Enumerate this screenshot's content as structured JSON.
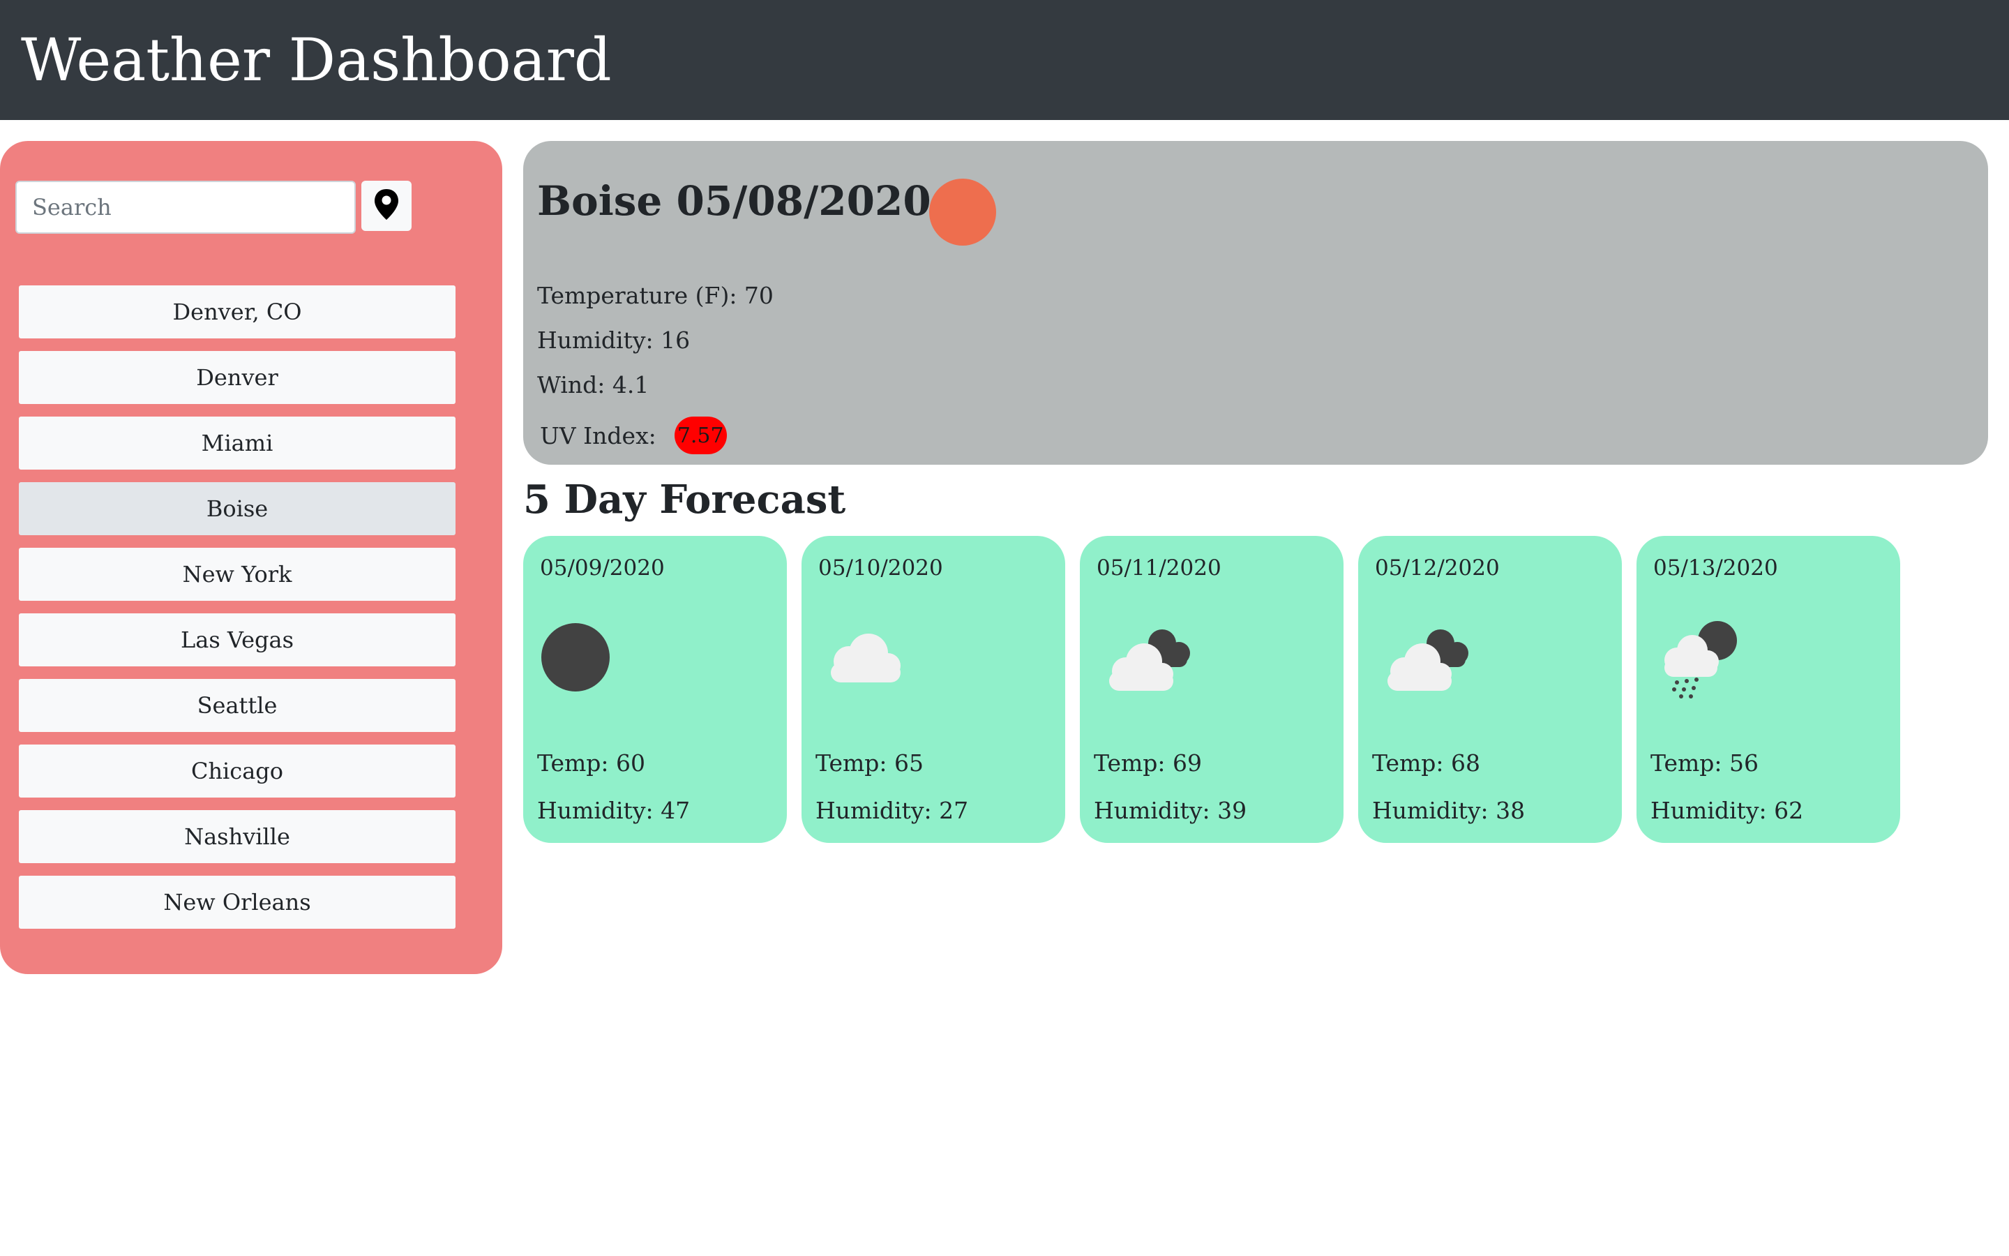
{
  "header": {
    "title": "Weather Dashboard"
  },
  "search": {
    "placeholder": "Search",
    "value": "",
    "locate_icon": "map-pin-icon"
  },
  "sidebar": {
    "active_city": "Boise",
    "cities": [
      "Denver, CO",
      "Denver",
      "Miami",
      "Boise",
      "New York",
      "Las Vegas",
      "Seattle",
      "Chicago",
      "Nashville",
      "New Orleans"
    ]
  },
  "current": {
    "title": "Boise 05/08/2020",
    "icon": "sun-icon",
    "temperature": "Temperature (F): 70",
    "humidity": "Humidity: 16",
    "wind": "Wind: 4.1",
    "uv_label": "UV Index:",
    "uv_value": "7.57",
    "uv_color": "#ff0000"
  },
  "forecast": {
    "heading": "5 Day Forecast",
    "days": [
      {
        "date": "05/09/2020",
        "icon": "clear-night-icon",
        "temp": "Temp: 60",
        "humidity": "Humidity: 47"
      },
      {
        "date": "05/10/2020",
        "icon": "cloud-icon",
        "temp": "Temp: 65",
        "humidity": "Humidity: 27"
      },
      {
        "date": "05/11/2020",
        "icon": "broken-clouds-icon",
        "temp": "Temp: 69",
        "humidity": "Humidity: 39"
      },
      {
        "date": "05/12/2020",
        "icon": "broken-clouds-icon",
        "temp": "Temp: 68",
        "humidity": "Humidity: 38"
      },
      {
        "date": "05/13/2020",
        "icon": "rain-night-icon",
        "temp": "Temp: 56",
        "humidity": "Humidity: 62"
      }
    ]
  },
  "colors": {
    "header_bg": "#343a40",
    "sidebar_bg": "#f08080",
    "current_bg": "#b5b9b9",
    "forecast_card_bg": "#90f0ca",
    "sun": "#ee6e4e"
  }
}
